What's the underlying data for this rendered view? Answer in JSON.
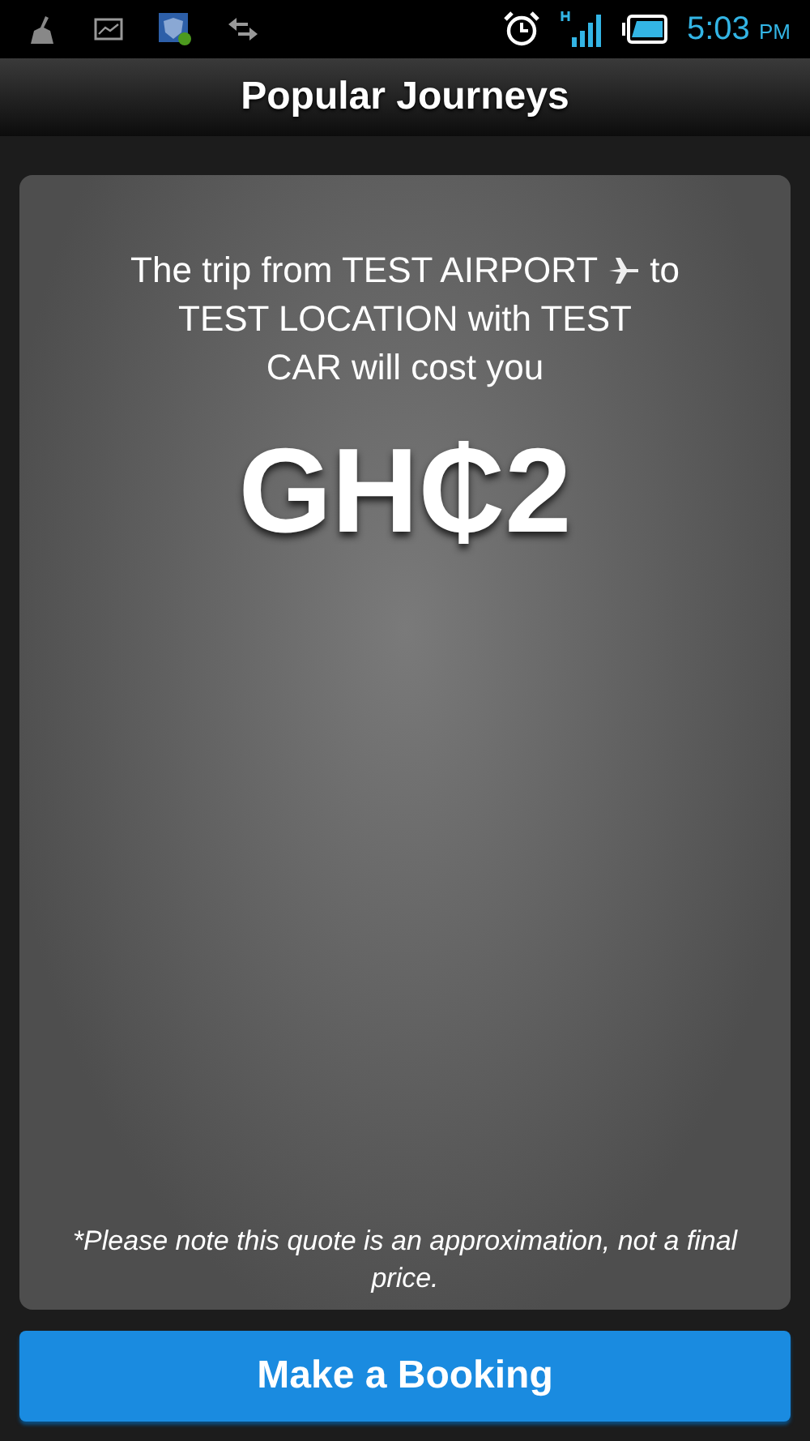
{
  "status_bar": {
    "time": "5:03",
    "ampm": "PM"
  },
  "title_bar": {
    "title": "Popular Journeys"
  },
  "quote": {
    "text_before_icon": "The trip from TEST AIRPORT",
    "text_after_icon": "to",
    "text_rest": "TEST LOCATION with TEST CAR will cost you",
    "price": "GH₵2",
    "note": "*Please note this quote is an approximation, not a final price."
  },
  "button": {
    "label": "Make a Booking"
  }
}
